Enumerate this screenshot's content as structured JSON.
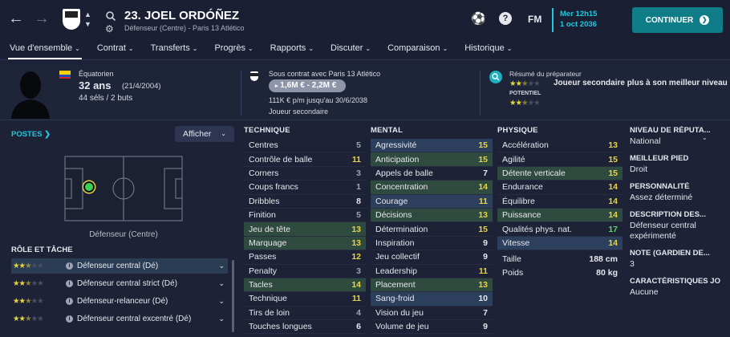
{
  "header": {
    "player_title": "23. JOEL ORDÓÑEZ",
    "player_subtitle": "Défenseur (Centre) - Paris 13 Atlético",
    "date_line1": "Mer 12h15",
    "date_line2": "1 oct 2036",
    "fm_label": "FM",
    "continue_label": "CONTINUER",
    "accent_color": "#0f7d88"
  },
  "nav": {
    "tabs": [
      "Vue d'ensemble",
      "Contrat",
      "Transferts",
      "Progrès",
      "Rapports",
      "Discuter",
      "Comparaison",
      "Historique"
    ]
  },
  "profile": {
    "nationality": "Équatorien",
    "age": "32 ans",
    "dob": "(21/4/2004)",
    "caps": "44 séls / 2 buts",
    "contract_title": "Sous contrat avec Paris 13 Atlético",
    "value_range": "1,6M € - 2,2M €",
    "wage": "111K € p/m jusqu'au 30/6/2038",
    "squad_status": "Joueur secondaire",
    "coach_report_title": "Résumé du préparateur",
    "coach_report_text": "Joueur secondaire plus à son meilleur niveau",
    "potential_label": "POTENTIEL"
  },
  "positions": {
    "title": "POSTES",
    "show_label": "Afficher",
    "position_name": "Défenseur (Centre)"
  },
  "roles": {
    "title": "RÔLE ET TÂCHE",
    "items": [
      {
        "name": "Défenseur central (Dé)",
        "stars": 2.5
      },
      {
        "name": "Défenseur central strict (Dé)",
        "stars": 2.5
      },
      {
        "name": "Défenseur-relanceur (Dé)",
        "stars": 2.5
      },
      {
        "name": "Défenseur central excentré (Dé)",
        "stars": 2.5
      }
    ]
  },
  "technique": {
    "title": "TECHNIQUE",
    "rows": [
      {
        "name": "Centres",
        "value": "5",
        "hl": ""
      },
      {
        "name": "Contrôle de balle",
        "value": "11",
        "hl": ""
      },
      {
        "name": "Corners",
        "value": "3",
        "hl": ""
      },
      {
        "name": "Coups francs",
        "value": "1",
        "hl": ""
      },
      {
        "name": "Dribbles",
        "value": "8",
        "hl": ""
      },
      {
        "name": "Finition",
        "value": "5",
        "hl": ""
      },
      {
        "name": "Jeu de tête",
        "value": "13",
        "hl": "green"
      },
      {
        "name": "Marquage",
        "value": "13",
        "hl": "green"
      },
      {
        "name": "Passes",
        "value": "12",
        "hl": ""
      },
      {
        "name": "Penalty",
        "value": "3",
        "hl": ""
      },
      {
        "name": "Tacles",
        "value": "14",
        "hl": "green"
      },
      {
        "name": "Technique",
        "value": "11",
        "hl": ""
      },
      {
        "name": "Tirs de loin",
        "value": "4",
        "hl": ""
      },
      {
        "name": "Touches longues",
        "value": "6",
        "hl": ""
      }
    ]
  },
  "mental": {
    "title": "MENTAL",
    "rows": [
      {
        "name": "Agressivité",
        "value": "15",
        "hl": "blue"
      },
      {
        "name": "Anticipation",
        "value": "15",
        "hl": "green"
      },
      {
        "name": "Appels de balle",
        "value": "7",
        "hl": ""
      },
      {
        "name": "Concentration",
        "value": "14",
        "hl": "green"
      },
      {
        "name": "Courage",
        "value": "11",
        "hl": "blue"
      },
      {
        "name": "Décisions",
        "value": "13",
        "hl": "green"
      },
      {
        "name": "Détermination",
        "value": "15",
        "hl": ""
      },
      {
        "name": "Inspiration",
        "value": "9",
        "hl": ""
      },
      {
        "name": "Jeu collectif",
        "value": "9",
        "hl": ""
      },
      {
        "name": "Leadership",
        "value": "11",
        "hl": ""
      },
      {
        "name": "Placement",
        "value": "13",
        "hl": "green"
      },
      {
        "name": "Sang-froid",
        "value": "10",
        "hl": "blue"
      },
      {
        "name": "Vision du jeu",
        "value": "7",
        "hl": ""
      },
      {
        "name": "Volume de jeu",
        "value": "9",
        "hl": ""
      }
    ]
  },
  "physique": {
    "title": "PHYSIQUE",
    "rows": [
      {
        "name": "Accélération",
        "value": "13",
        "hl": ""
      },
      {
        "name": "Agilité",
        "value": "15",
        "hl": ""
      },
      {
        "name": "Détente verticale",
        "value": "15",
        "hl": "green"
      },
      {
        "name": "Endurance",
        "value": "14",
        "hl": ""
      },
      {
        "name": "Équilibre",
        "value": "14",
        "hl": ""
      },
      {
        "name": "Puissance",
        "value": "14",
        "hl": "green"
      },
      {
        "name": "Qualités phys. nat.",
        "value": "17",
        "hl": ""
      },
      {
        "name": "Vitesse",
        "value": "14",
        "hl": "blue"
      }
    ],
    "height_label": "Taille",
    "height": "188 cm",
    "weight_label": "Poids",
    "weight": "80 kg"
  },
  "right_panel": [
    {
      "h": "NIVEAU DE RÉPUTA...",
      "v": "National"
    },
    {
      "h": "MEILLEUR PIED",
      "v": "Droit"
    },
    {
      "h": "PERSONNALITÉ",
      "v": "Assez déterminé"
    },
    {
      "h": "DESCRIPTION DES...",
      "v": "Défenseur central expérimenté"
    },
    {
      "h": "NOTE (GARDIEN DE...",
      "v": "3"
    },
    {
      "h": "CARACTÉRISTIQUES JO",
      "v": "Aucune"
    }
  ]
}
